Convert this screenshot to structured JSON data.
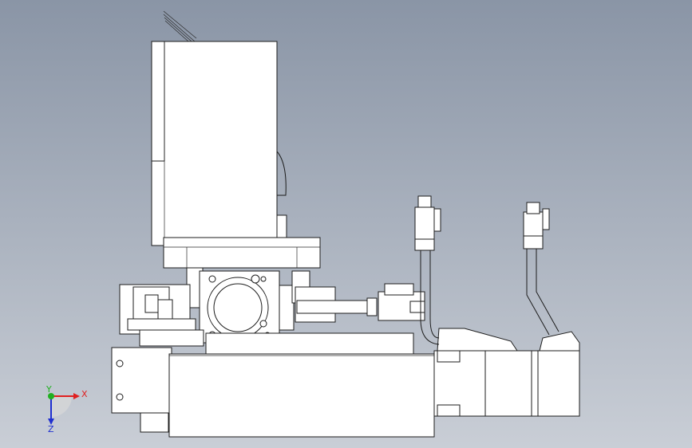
{
  "viewport": {
    "background_top": "#8a95a6",
    "background_bottom": "#c9ced6",
    "line_color": "#1c1c1c",
    "fill_color": "#ffffff"
  },
  "triad": {
    "x_label": "X",
    "y_label": "Y",
    "z_label": "Z",
    "x_color": "#e02020",
    "y_color": "#20b020",
    "z_color": "#2030d0"
  }
}
